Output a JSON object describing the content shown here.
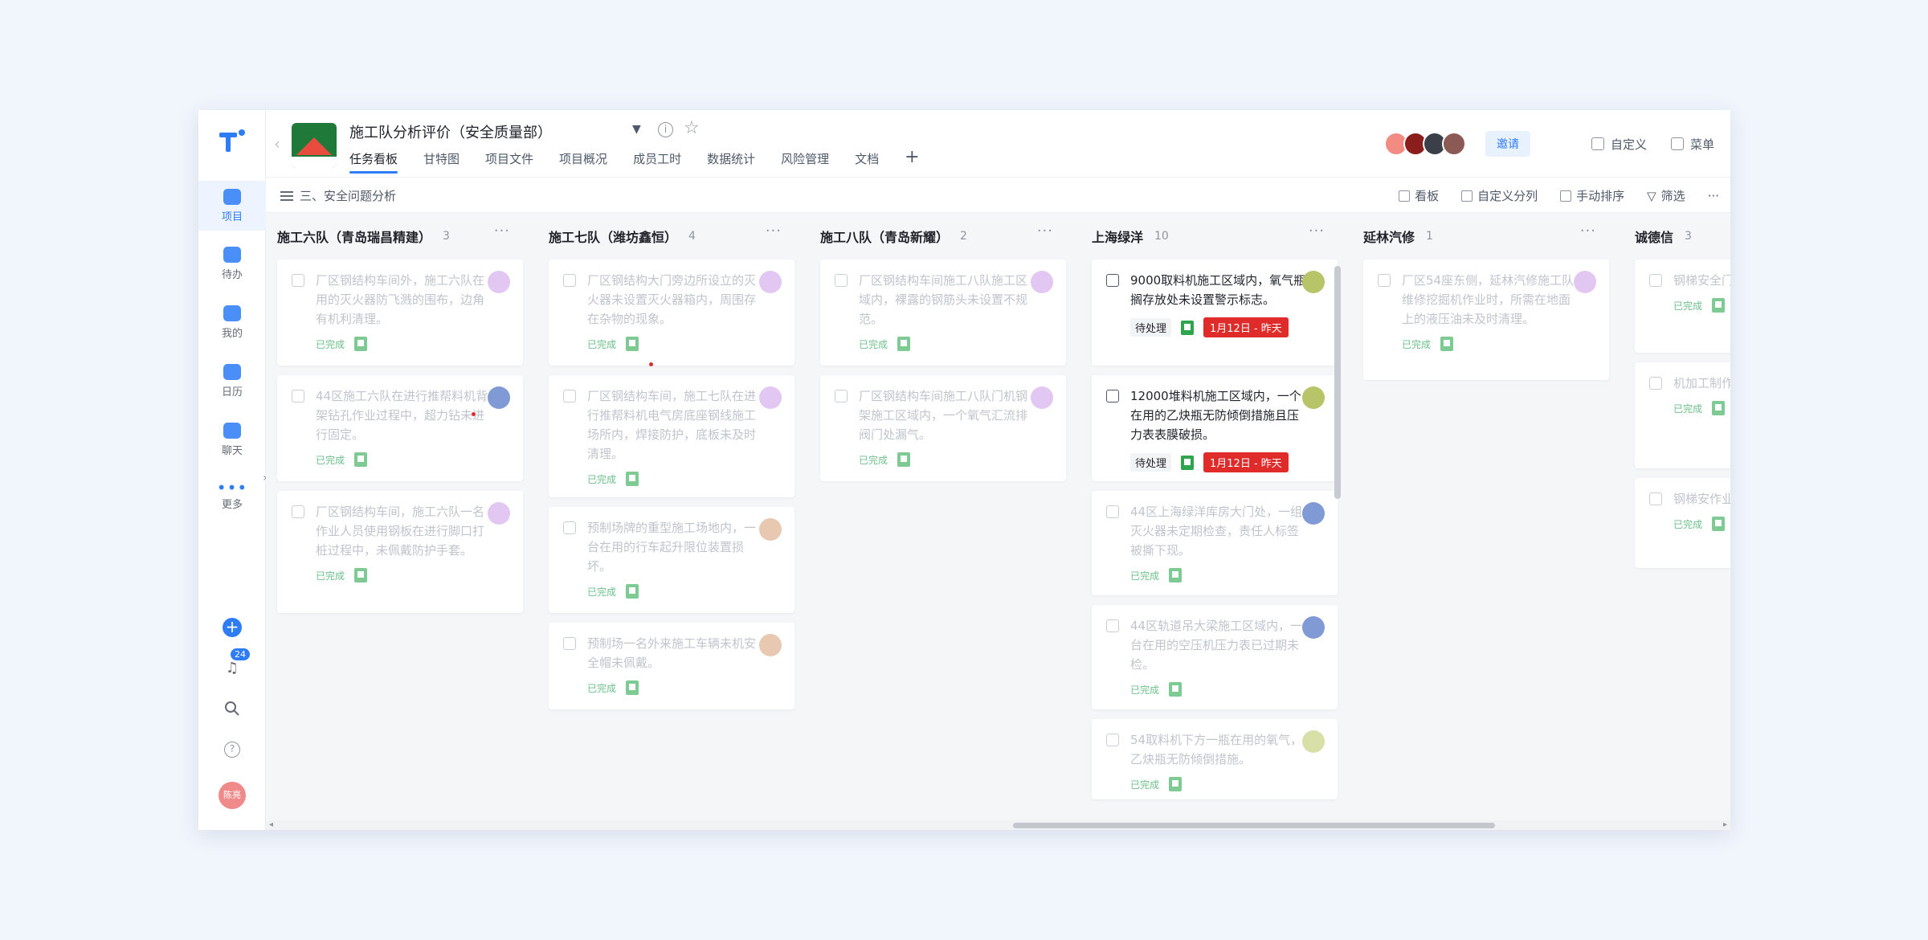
{
  "header": {
    "project_title": "施工队分析评价（安全质量部）",
    "tabs": [
      "任务看板",
      "甘特图",
      "项目文件",
      "项目概况",
      "成员工时",
      "数据统计",
      "风险管理",
      "文档"
    ],
    "invite_label": "邀请",
    "customize_label": "自定义",
    "menu_label": "菜单",
    "member_colors": [
      "#f28b82",
      "#8b1d1d",
      "#3b3f47",
      "#8c5a55"
    ]
  },
  "rail": {
    "items": [
      "项目",
      "待办",
      "我的",
      "日历",
      "聊天",
      "更多"
    ],
    "notification_count": "24",
    "avatar_text": "陈亮",
    "accent": "#2e7cf6"
  },
  "toolbar": {
    "filter_label": "三、安全问题分析",
    "view_label": "看板",
    "group_label": "自定义分列",
    "sort_label": "手动排序",
    "filter_btn_label": "筛选",
    "more": "···"
  },
  "columns": [
    {
      "title": "施工六队（青岛瑞昌精建）",
      "count": "3",
      "cards": [
        {
          "text": "厂区钢结构车间外，施工六队在用的灭火器防飞溅的围布，边角有机利清理。",
          "status": "已完成",
          "avatar": "#e3c7f3",
          "active": false
        },
        {
          "text": "44区施工六队在进行推帮料机背架钻孔作业过程中，超力钻未进行固定。",
          "status": "已完成",
          "avatar": "#7f9ad4",
          "active": false
        },
        {
          "text": "厂区钢结构车间，施工六队一名作业人员使用钢板在进行脚口打桩过程中，未佩戴防护手套。",
          "status": "已完成",
          "avatar": "#e3c7f3",
          "active": false
        }
      ]
    },
    {
      "title": "施工七队（潍坊鑫恒）",
      "count": "4",
      "cards": [
        {
          "text": "厂区钢结构大门旁边所设立的灭火器未设置灭火器箱内，周围存在杂物的现象。",
          "status": "已完成",
          "avatar": "#e3c7f3",
          "active": false
        },
        {
          "text": "厂区钢结构车间，施工七队在进行推帮料机电气房底座钢线施工场所内，焊接防护，底板未及时清理。",
          "status": "已完成",
          "avatar": "#e3c7f3",
          "active": false
        },
        {
          "text": "预制场牌的重型施工场地内，一台在用的行车起升限位装置损坏。",
          "status": "已完成",
          "avatar": "#e8c8b0",
          "active": false
        },
        {
          "text": "预制场一名外来施工车辆未机安全帽未佩戴。",
          "status": "已完成",
          "avatar": "#e8c8b0",
          "active": false
        }
      ]
    },
    {
      "title": "施工八队（青岛新耀）",
      "count": "2",
      "cards": [
        {
          "text": "厂区钢结构车间施工八队施工区域内，裸露的钢筋头未设置不规范。",
          "status": "已完成",
          "avatar": "#e3c7f3",
          "active": false
        },
        {
          "text": "厂区钢结构车间施工八队门机钢架施工区域内，一个氧气汇流排阀门处漏气。",
          "status": "已完成",
          "avatar": "#e3c7f3",
          "active": false
        }
      ]
    },
    {
      "title": "上海绿洋",
      "count": "10",
      "cards": [
        {
          "text": "9000取料机施工区域内，氧气瓶搁存放处未设置警示标志。",
          "status": "待处理",
          "date": "1月12日 - 昨天",
          "avatar": "#b7c468",
          "active": true
        },
        {
          "text": "12000堆料机施工区域内，一个在用的乙炔瓶无防倾倒措施且压力表表膜破损。",
          "status": "待处理",
          "date": "1月12日 - 昨天",
          "avatar": "#b7c468",
          "active": true
        },
        {
          "text": "44区上海绿洋库房大门处，一组灭火器未定期检查，责任人标签被撕下现。",
          "status": "已完成",
          "avatar": "#7f9ad4",
          "active": false
        },
        {
          "text": "44区轨道吊大梁施工区域内，一台在用的空压机压力表已过期未检。",
          "status": "已完成",
          "avatar": "#7f9ad4",
          "active": false
        },
        {
          "text": "54取料机下方一瓶在用的氧气，乙炔瓶无防倾倒措施。",
          "status": "已完成",
          "avatar": "#d8e0a8",
          "active": false
        }
      ]
    },
    {
      "title": "延林汽修",
      "count": "1",
      "cards": [
        {
          "text": "厂区54座东侧，延林汽修施工队维修挖掘机作业时，所需在地面上的液压油未及时清理。",
          "status": "已完成",
          "avatar": "#e3c7f3",
          "active": false
        }
      ]
    },
    {
      "title": "诚德信",
      "count": "3",
      "cards": [
        {
          "text": "钢梯安全门未已作业",
          "status": "已完成",
          "avatar": "",
          "active": false
        },
        {
          "text": "机加工制作区反警示",
          "status": "已完成",
          "avatar": "",
          "active": false
        },
        {
          "text": "钢梯安作业人电源线",
          "status": "已完成",
          "avatar": "",
          "active": false
        }
      ]
    }
  ]
}
